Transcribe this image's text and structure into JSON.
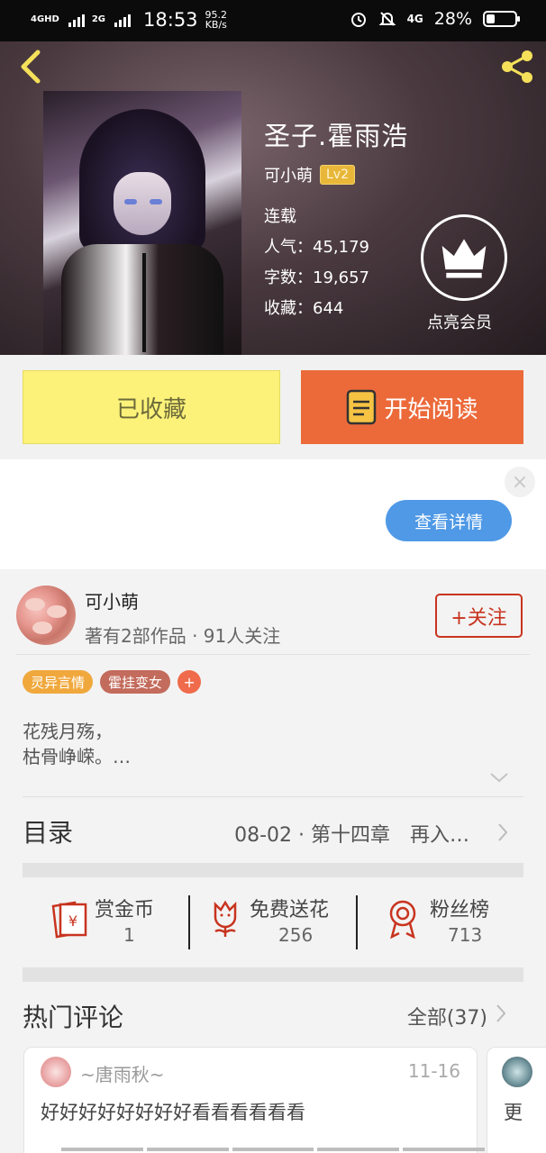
{
  "status_bar": {
    "signal1": "4GHD",
    "signal2": "2G",
    "time": "18:53",
    "speed_value": "95.2",
    "speed_unit": "KB/s",
    "network": "4G",
    "battery": "28%",
    "battery_level": 0.28
  },
  "book": {
    "title": "圣子.霍雨浩",
    "author": "可小萌",
    "level": "Lv2",
    "status": "连载",
    "popularity": "人气：45,179",
    "word_count": "字数：19,657",
    "favorites": "收藏：644",
    "vip_label": "点亮会员"
  },
  "actions": {
    "collected_label": "已收藏",
    "read_label": "开始阅读"
  },
  "ad": {
    "close": "×",
    "details_label": "查看详情"
  },
  "author_info": {
    "name": "可小萌",
    "sub": "著有2部作品 · 91人关注",
    "follow_label": "+关注"
  },
  "tags": [
    "灵异言情",
    "霍挂变女",
    "+"
  ],
  "description": {
    "line1": "花残月殇，",
    "line2": "枯骨峥嵘。…"
  },
  "toc": {
    "title": "目录",
    "latest": "08-02 · 第十四章　再入…"
  },
  "stats": {
    "reward_label": "赏金币",
    "reward_value": "1",
    "flower_label": "免费送花",
    "flower_value": "256",
    "fans_label": "粉丝榜",
    "fans_value": "713"
  },
  "comments": {
    "title": "热门评论",
    "all_label": "全部(37)",
    "items": [
      {
        "user": "~唐雨秋~",
        "date": "11-16",
        "text": "好好好好好好好好看看看看看看"
      },
      {
        "text": "更"
      }
    ]
  },
  "colors": {
    "accent_orange": "#ec6a3a",
    "collected_yellow": "#fcf27a",
    "follow_red": "#c8341f",
    "details_blue": "#4f99e6"
  }
}
